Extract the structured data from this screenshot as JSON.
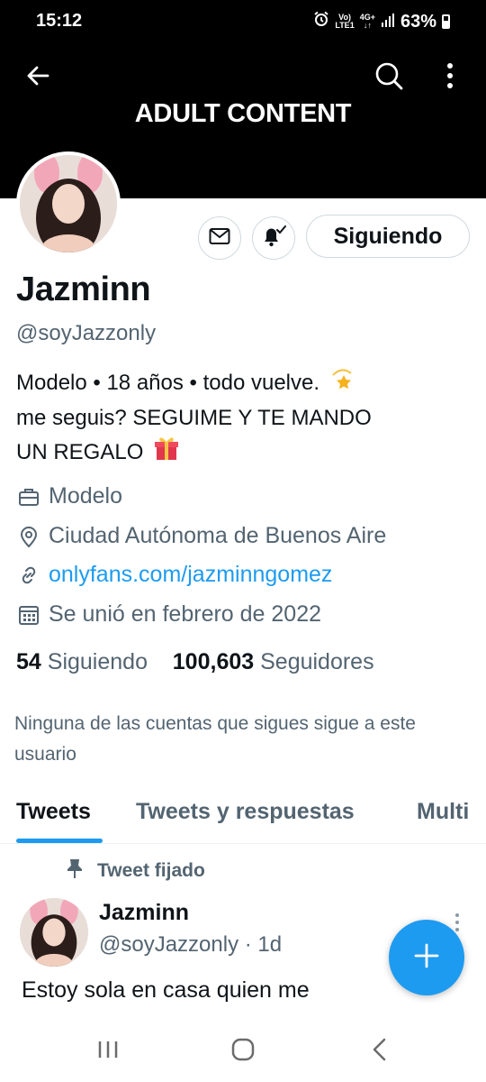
{
  "status_bar": {
    "time": "15:12",
    "signal_line1": "Vo)",
    "signal_line2": "LTE1",
    "net_line1": "4G+",
    "net_line2": "↓↑",
    "battery": "63%"
  },
  "header": {
    "banner_text": "ADULT CONTENT"
  },
  "profile": {
    "follow_label": "Siguiendo",
    "name": "Jazminn",
    "handle": "@soyJazzonly",
    "bio_line1": "Modelo • 18 años • todo vuelve.",
    "bio_line2": "me seguis? SEGUIME Y TE MANDO",
    "bio_line3": "UN REGALO",
    "profession": "Modelo",
    "location": "Ciudad Autónoma de Buenos Aire",
    "website": "onlyfans.com/jazminngomez",
    "joined": "Se unió en febrero de 2022",
    "following_count": "54",
    "following_label": "Siguiendo",
    "followers_count": "100,603",
    "followers_label": "Seguidores",
    "mutuals_note": "Ninguna de las cuentas que sigues sigue a este usuario"
  },
  "tabs": [
    {
      "label": "Tweets"
    },
    {
      "label": "Tweets y respuestas"
    },
    {
      "label": "Multi"
    }
  ],
  "pinned_tweet": {
    "pinned_label": "Tweet fijado",
    "author_name": "Jazminn",
    "author_handle": "@soyJazzonly",
    "time": "1d",
    "text": "Estoy sola en casa quien me"
  },
  "colors": {
    "accent": "#1d9bf0",
    "secondary_text": "#536471",
    "header_bg": "#000000"
  },
  "icons": {
    "back": "back-arrow-icon",
    "search": "search-icon",
    "more": "more-vertical-icon",
    "message": "envelope-icon",
    "notifications": "bell-check-icon",
    "compose": "plus-icon"
  }
}
